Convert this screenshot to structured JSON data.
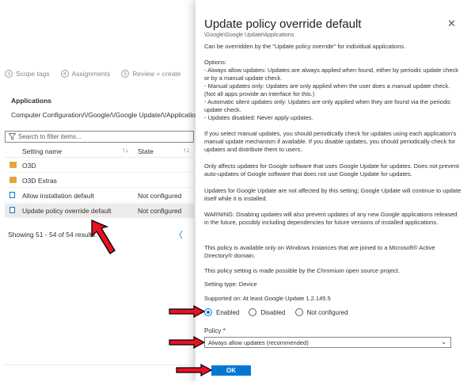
{
  "steps": [
    {
      "num": "3",
      "label": "Scope tags"
    },
    {
      "num": "4",
      "label": "Assignments"
    },
    {
      "num": "5",
      "label": "Review + create"
    }
  ],
  "applications": {
    "title": "Applications",
    "path": "Computer Configuration/\\/Google/\\/Google Update/\\/Applications",
    "search_placeholder": "Search to filter items...",
    "columns": {
      "setting_name": "Setting name",
      "state": "State",
      "sort_icon": "↑↓"
    },
    "rows": [
      {
        "icon": "folder-icon",
        "name": "O3D",
        "state": ""
      },
      {
        "icon": "folder-icon",
        "name": "O3D Extras",
        "state": ""
      },
      {
        "icon": "document-icon",
        "name": "Allow installation default",
        "state": "Not configured"
      },
      {
        "icon": "document-icon",
        "name": "Update policy override default",
        "state": "Not configured"
      }
    ],
    "showing": "Showing 51 - 54 of 54 results.",
    "prev_glyph": "〈"
  },
  "panel": {
    "title": "Update policy override default",
    "close_glyph": "✕",
    "subpath": "\\Google\\Google Update\\Applications",
    "intro": "Can be overridden by the \"Update policy override\" for individual applications.",
    "options": "Options:\n - Always allow updates: Updates are always applied when found, either by periodic update check or by a manual update check.\n - Manual updates only: Updates are only applied when the user does a manual update check. (Not all apps provide an interface for this.)\n - Automatic silent updates only: Updates are only applied when they are found via the periodic update check.\n - Updates disabled: Never apply updates.",
    "para_manual": "If you select manual updates, you should periodically check for updates using each application's manual update mechanism if available. If you disable updates, you should periodically check for updates and distribute them to users.",
    "para_affects": "Only affects updates for Google software that uses Google Update for updates. Does not prevent auto-updates of Google software that does not use Google Update for updates.",
    "para_gu": "Updates for Google Update are not affected by this setting; Google Update will continue to update itself while it is installed.",
    "para_warning": "WARNING: Disabing updates will also prevent updates of any new Google applications released in the future, possibly including dependencies for future versions of installed applications.",
    "para_domain": "This policy is available only on Windows instances that are joined to a Microsoft® Active Directory® domain.",
    "para_chromium": "This policy setting is made possible by the Chromium open source project.",
    "setting_type": "Setting type: Device",
    "supported_on": "Supported on: At least Google Update 1.2.145.5",
    "radios": [
      {
        "label": "Enabled",
        "checked": true
      },
      {
        "label": "Disabled",
        "checked": false
      },
      {
        "label": "Not configured",
        "checked": false
      }
    ],
    "policy_label": "Policy *",
    "policy_value": "Always allow updates (recommended)",
    "chevron": "⌄",
    "ok_label": "OK"
  },
  "colors": {
    "accent": "#0078d4",
    "arrow": "#e81123",
    "folder": "#e8a33d"
  }
}
